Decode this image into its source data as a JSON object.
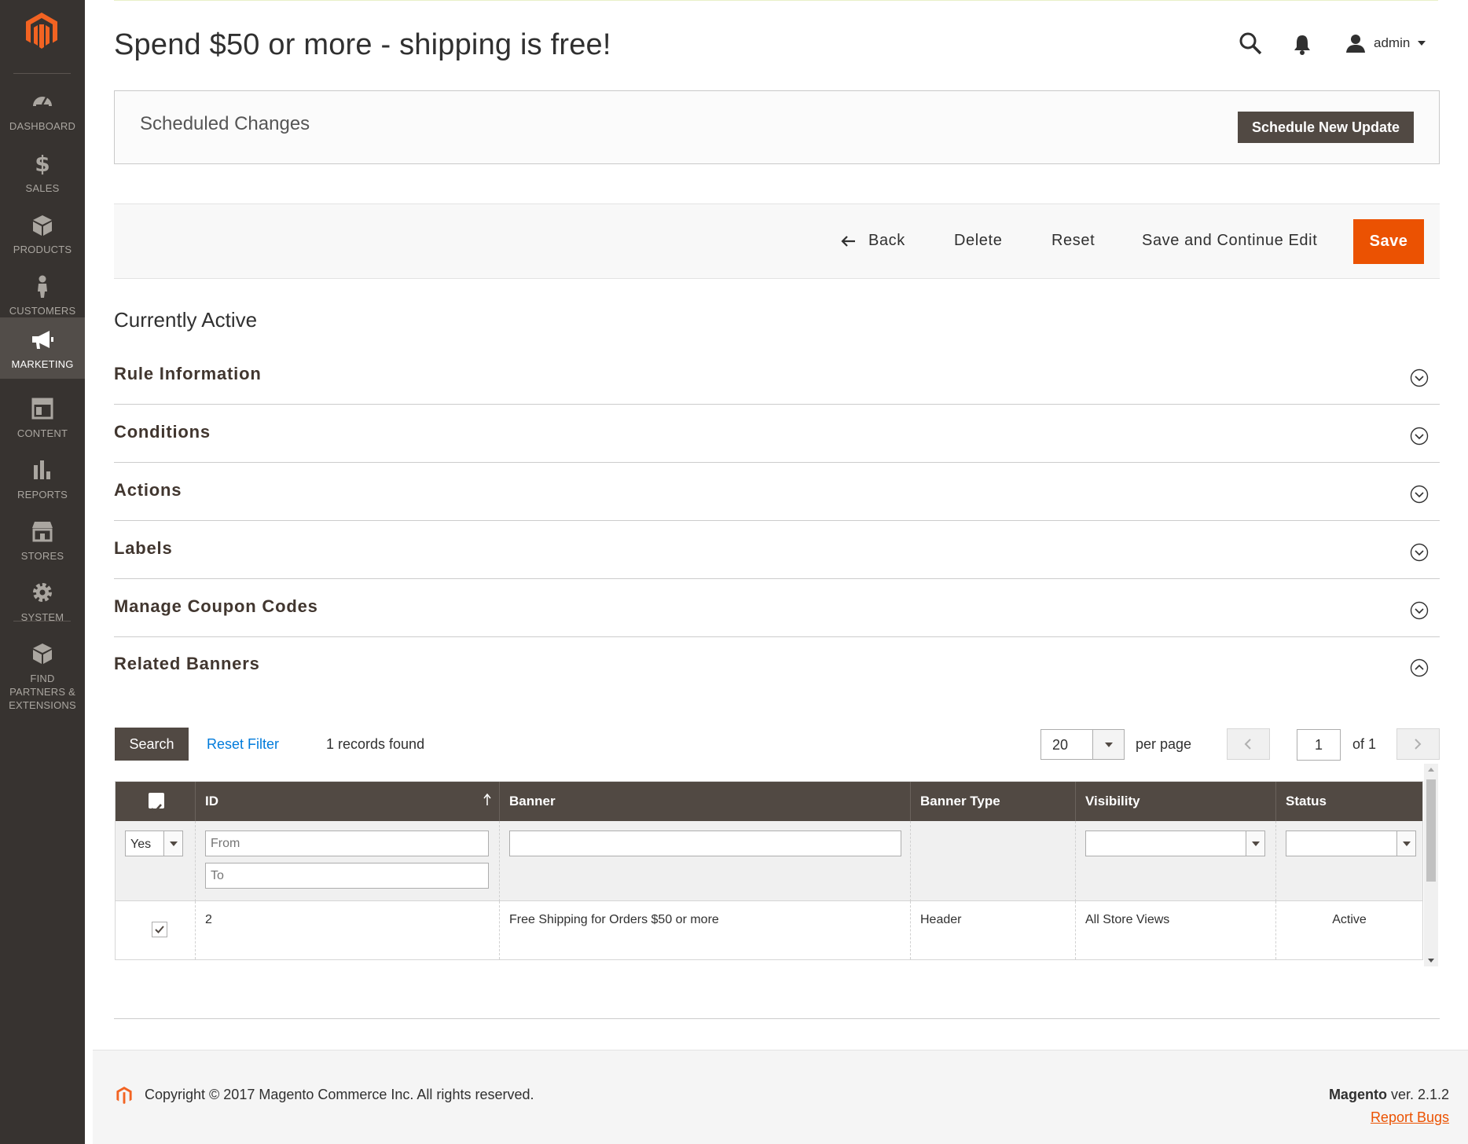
{
  "sidebar": {
    "items": [
      {
        "label": "DASHBOARD",
        "icon": "dashboard-icon"
      },
      {
        "label": "SALES",
        "icon": "dollar-icon"
      },
      {
        "label": "PRODUCTS",
        "icon": "box-icon"
      },
      {
        "label": "CUSTOMERS",
        "icon": "person-icon"
      },
      {
        "label": "MARKETING",
        "icon": "megaphone-icon",
        "active": true
      },
      {
        "label": "CONTENT",
        "icon": "layout-icon"
      },
      {
        "label": "REPORTS",
        "icon": "bar-chart-icon"
      },
      {
        "label": "STORES",
        "icon": "storefront-icon"
      },
      {
        "label": "SYSTEM",
        "icon": "gear-icon"
      },
      {
        "label": "FIND PARTNERS & EXTENSIONS",
        "icon": "cubes-icon"
      }
    ]
  },
  "header": {
    "title": "Spend $50 or more - shipping is free!",
    "user": "admin"
  },
  "scheduled": {
    "title": "Scheduled Changes",
    "button": "Schedule New Update"
  },
  "actions": {
    "back": "Back",
    "delete": "Delete",
    "reset": "Reset",
    "save_continue": "Save and Continue Edit",
    "save": "Save"
  },
  "currently_active": "Currently Active",
  "sections": [
    {
      "title": "Rule Information",
      "open": false
    },
    {
      "title": "Conditions",
      "open": false
    },
    {
      "title": "Actions",
      "open": false
    },
    {
      "title": "Labels",
      "open": false
    },
    {
      "title": "Manage Coupon Codes",
      "open": false
    },
    {
      "title": "Related Banners",
      "open": true
    }
  ],
  "grid": {
    "search": "Search",
    "reset_filter": "Reset Filter",
    "records": "1 records found",
    "per_page_value": "20",
    "per_page_label": "per page",
    "page": "1",
    "of_pages": "of 1",
    "columns": [
      "ID",
      "Banner",
      "Banner Type",
      "Visibility",
      "Status"
    ],
    "filters": {
      "selected": "Yes",
      "id_from_placeholder": "From",
      "id_to_placeholder": "To"
    },
    "rows": [
      {
        "checked": true,
        "id": "2",
        "banner": "Free Shipping for Orders $50 or more",
        "type": "Header",
        "visibility": "All Store Views",
        "status": "Active"
      }
    ]
  },
  "footer": {
    "copyright": "Copyright © 2017 Magento Commerce Inc. All rights reserved.",
    "brand": "Magento",
    "version": " ver. 2.1.2",
    "report_bugs": "Report Bugs"
  },
  "colors": {
    "sidebar_bg": "#373330",
    "accent": "#eb5202",
    "dark_button": "#514943",
    "link": "#007bdb"
  }
}
